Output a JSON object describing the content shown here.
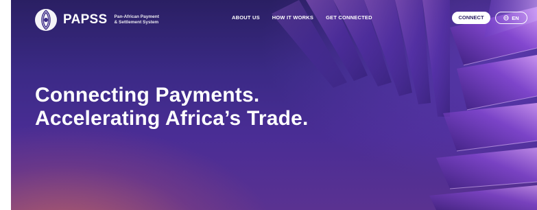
{
  "brand": {
    "name": "PAPSS",
    "subtitle_line1": "Pan-African Payment",
    "subtitle_line2": "& Settlement System",
    "logo_icon": "papss-logo-icon"
  },
  "nav": {
    "items": [
      {
        "label": "ABOUT US"
      },
      {
        "label": "HOW IT WORKS"
      },
      {
        "label": "GET CONNECTED"
      }
    ]
  },
  "header_actions": {
    "connect_label": "CONNECT",
    "language_label": "EN",
    "language_icon": "globe-icon"
  },
  "hero": {
    "line1": "Connecting Payments.",
    "line2": "Accelerating Africa’s Trade."
  },
  "colors": {
    "hero_top": "#2a1f63",
    "hero_mid": "#4a2d95",
    "accent_glow": "#d26e5a",
    "text": "#ffffff"
  }
}
